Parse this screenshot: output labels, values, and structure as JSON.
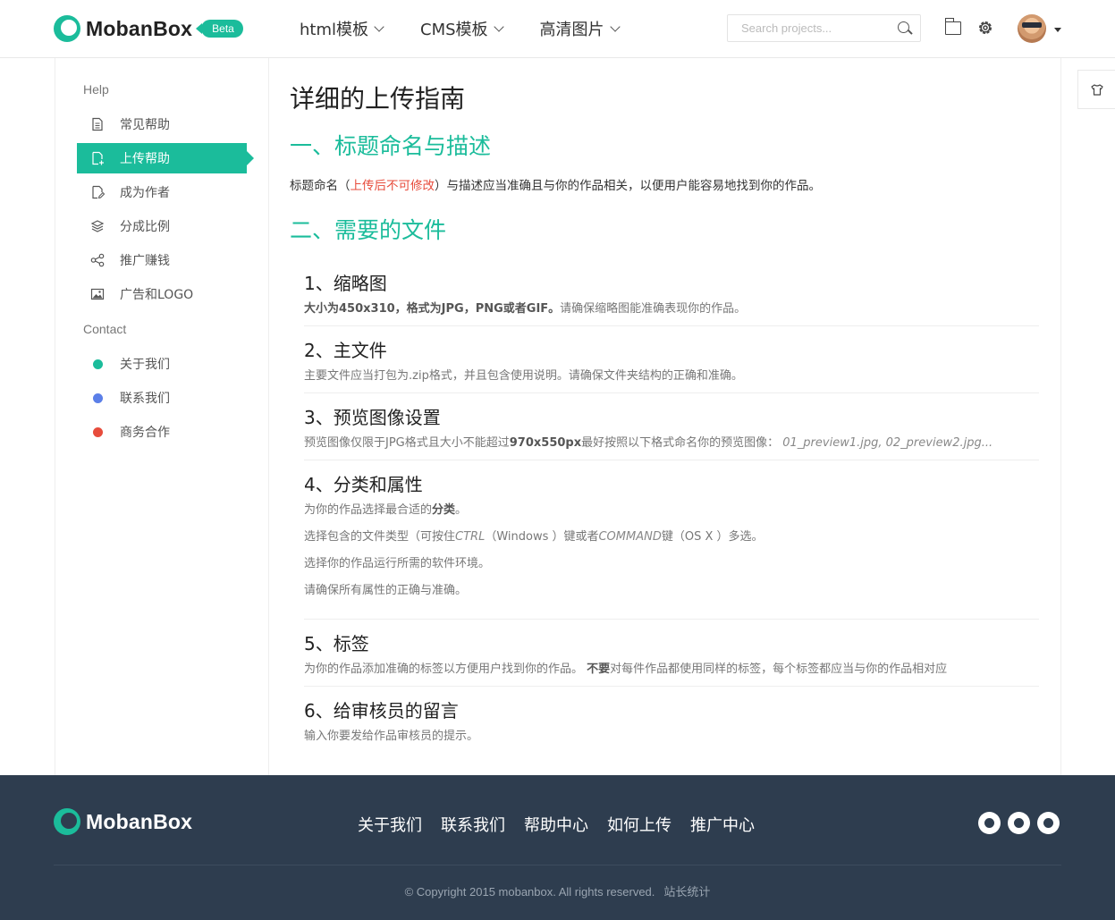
{
  "header": {
    "logo_text": "MobanBox",
    "beta_label": "Beta",
    "nav": [
      {
        "label": "html模板"
      },
      {
        "label": "CMS模板"
      },
      {
        "label": "高清图片"
      }
    ],
    "search_placeholder": "Search projects..."
  },
  "sidebar": {
    "help_heading": "Help",
    "help_items": [
      {
        "label": "常见帮助",
        "icon": "document-icon"
      },
      {
        "label": "上传帮助",
        "icon": "upload-document-icon",
        "active": true
      },
      {
        "label": "成为作者",
        "icon": "edit-document-icon"
      },
      {
        "label": "分成比例",
        "icon": "stack-icon"
      },
      {
        "label": "推广赚钱",
        "icon": "share-icon"
      },
      {
        "label": "广告和LOGO",
        "icon": "image-icon"
      }
    ],
    "contact_heading": "Contact",
    "contact_items": [
      {
        "label": "关于我们",
        "color": "#1bbc9b"
      },
      {
        "label": "联系我们",
        "color": "#5b7fe8"
      },
      {
        "label": "商务合作",
        "color": "#e74c3c"
      }
    ]
  },
  "content": {
    "title": "详细的上传指南",
    "section1_title": "一、标题命名与描述",
    "intro_before": "标题命名（",
    "intro_red": "上传后不可修改",
    "intro_after": "）与描述应当准确且与你的作品相关，以便用户能容易地找到你的作品。",
    "section2_title": "二、需要的文件",
    "items": [
      {
        "title": "1、缩略图",
        "t1": "大小为450x310，格式为JPG，PNG或者GIF。",
        "t2": "请确保缩略图能准确表现你的作品。"
      },
      {
        "title": "2、主文件",
        "t1": "主要文件应当打包为.zip格式，并且包含使用说明。请确保文件夹结构的正确和准确。"
      },
      {
        "title": "3、预览图像设置",
        "t1": "预览图像仅限于JPG格式且大小不能超过",
        "t2": "970x550px",
        "t3": "最好按照以下格式命名你的预览图像：",
        "t4": "01_preview1.jpg, 02_preview2.jpg..."
      },
      {
        "title": "4、分类和属性",
        "l1a": "为你的作品选择最合适的",
        "l1b": "分类",
        "l1c": "。",
        "l2a": "选择包含的文件类型（可按住",
        "l2b": "CTRL",
        "l2c": "（Windows ）键或者",
        "l2d": "COMMAND",
        "l2e": "键（OS X ）多选。",
        "l3": "选择你的作品运行所需的软件环境。",
        "l4": "请确保所有属性的正确与准确。"
      },
      {
        "title": "5、标签",
        "t1": "为你的作品添加准确的标签以方便用户找到你的作品。",
        "t2": "不要",
        "t3": "对每件作品都使用同样的标签，每个标签都应当与你的作品相对应"
      },
      {
        "title": "6、给审核员的留言",
        "t1": "输入你要发给作品审核员的提示。"
      }
    ]
  },
  "footer": {
    "logo_text": "MobanBox",
    "links": [
      "关于我们",
      "联系我们",
      "帮助中心",
      "如何上传",
      "推广中心"
    ],
    "social_icons": [
      "wechat-icon",
      "weibo-icon",
      "qq-icon"
    ],
    "copyright": "© Copyright 2015 mobanbox. All rights reserved.",
    "stats_link": "站长统计"
  },
  "colors": {
    "accent": "#1bbc9b",
    "footer_bg": "#2e3d4f",
    "warning": "#e74c3c"
  }
}
